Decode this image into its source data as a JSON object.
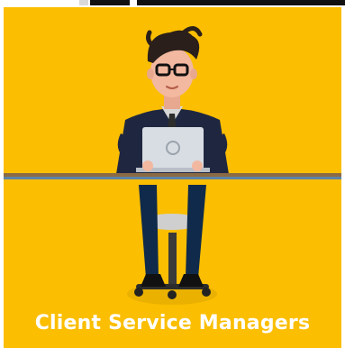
{
  "caption": "Client Service Managers",
  "colors": {
    "background": "#fbbe00",
    "caption_text": "#ffffff",
    "desk_top": "#8a6a45",
    "desk_stripe": "#5d83a6",
    "jacket": "#1f2740",
    "pants": "#0f2a4a",
    "hair": "#2a1f1a",
    "skin": "#f2b8a0",
    "laptop": "#d8dde3"
  }
}
